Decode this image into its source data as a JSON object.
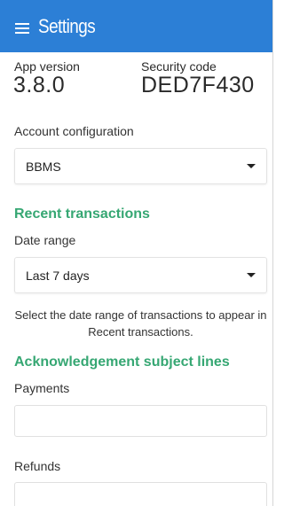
{
  "header": {
    "title": "Settings",
    "menu_icon": "hamburger-menu-icon",
    "background_color": "#2c7fd6"
  },
  "app_info": {
    "version_label": "App version",
    "version_value": "3.8.0",
    "security_label": "Security code",
    "security_value": "DED7F430"
  },
  "account_configuration": {
    "label": "Account configuration",
    "selected": "BBMS"
  },
  "recent_transactions": {
    "heading": "Recent transactions",
    "date_range_label": "Date range",
    "date_range_selected": "Last 7 days",
    "helper_text": "Select the date range of transactions to appear in Recent transactions."
  },
  "acknowledgement": {
    "heading": "Acknowledgement subject lines",
    "payments_label": "Payments",
    "payments_value": "",
    "refunds_label": "Refunds",
    "refunds_value": ""
  },
  "colors": {
    "accent_green": "#36a773"
  }
}
